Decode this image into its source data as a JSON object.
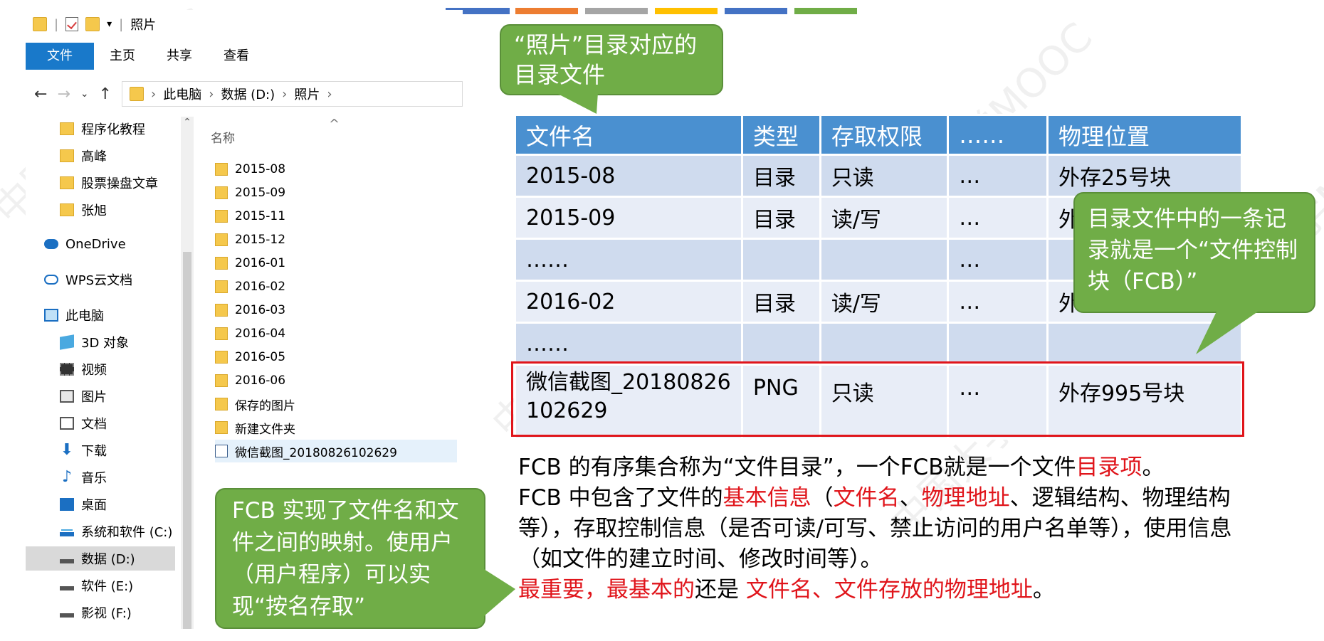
{
  "colors": {
    "strip": [
      "#4472c4",
      "#ed7d31",
      "#a5a5a5",
      "#ffc000",
      "#4472c4",
      "#70ad47"
    ],
    "accent_blue": "#1979ca",
    "table_header": "#4a90d0",
    "callout_green": "#70ad47",
    "highlight_red": "#e0151b"
  },
  "explorer": {
    "title": "照片",
    "ribbon_tabs": [
      "文件",
      "主页",
      "共享",
      "查看"
    ],
    "address": [
      "此电脑",
      "数据 (D:)",
      "照片"
    ],
    "nav_items": [
      {
        "label": "程序化教程",
        "icon": "folder-icon"
      },
      {
        "label": "高峰",
        "icon": "folder-icon"
      },
      {
        "label": "股票操盘文章",
        "icon": "folder-icon"
      },
      {
        "label": "张旭",
        "icon": "folder-icon"
      },
      {
        "label": "OneDrive",
        "icon": "onedrive-icon"
      },
      {
        "label": "WPS云文档",
        "icon": "wps-cloud-icon"
      },
      {
        "label": "此电脑",
        "icon": "computer-icon"
      },
      {
        "label": "3D 对象",
        "icon": "3d-objects-icon"
      },
      {
        "label": "视频",
        "icon": "video-icon"
      },
      {
        "label": "图片",
        "icon": "pictures-icon"
      },
      {
        "label": "文档",
        "icon": "documents-icon"
      },
      {
        "label": "下载",
        "icon": "download-icon"
      },
      {
        "label": "音乐",
        "icon": "music-icon"
      },
      {
        "label": "桌面",
        "icon": "desktop-icon"
      },
      {
        "label": "系统和软件 (C:)",
        "icon": "system-drive-icon"
      },
      {
        "label": "数据 (D:)",
        "icon": "drive-icon"
      },
      {
        "label": "软件 (E:)",
        "icon": "drive-icon"
      },
      {
        "label": "影视 (F:)",
        "icon": "drive-icon"
      }
    ],
    "column_header": "名称",
    "files": [
      "2015-08",
      "2015-09",
      "2015-11",
      "2015-12",
      "2016-01",
      "2016-02",
      "2016-03",
      "2016-04",
      "2016-05",
      "2016-06",
      "保存的图片",
      "新建文件夹",
      "微信截图_20180826102629"
    ]
  },
  "table": {
    "headers": [
      "文件名",
      "类型",
      "存取权限",
      "……",
      "物理位置"
    ],
    "rows": [
      [
        "2015-08",
        "目录",
        "只读",
        "…",
        "外存25号块"
      ],
      [
        "2015-09",
        "目录",
        "读/写",
        "…",
        "外"
      ],
      [
        "……",
        "",
        "",
        "…",
        ""
      ],
      [
        "2016-02",
        "目录",
        "读/写",
        "…",
        "外存"
      ],
      [
        "……",
        "",
        "",
        "",
        ""
      ],
      [
        "微信截图_20180826102629",
        "PNG",
        "只读",
        "…",
        "外存995号块"
      ]
    ]
  },
  "callouts": {
    "top": "“照片”目录对应的目录文件",
    "right": "目录文件中的一条记录就是一个“文件控制块（FCB）”",
    "bottom_left": "FCB 实现了文件名和文件之间的映射。使用户（用户程序）可以实现“按名存取”"
  },
  "paragraph": {
    "p1_a": "FCB 的有序集合称为“文件目录”，一个FCB就是一个文件",
    "p1_red": "目录项",
    "p1_b": "。",
    "p2_a": "FCB 中包含了文件的",
    "p2_red1": "基本信息",
    "p2_b": "（",
    "p2_red2": "文件名",
    "p2_c": "、",
    "p2_red3": "物理地址",
    "p2_d": "、逻辑结构、物理结构等），存取控制信息（是否可读/可写、禁止访问的用户名单等），使用信息（如文件的建立时间、修改时间等）。",
    "p3_red1": "最重要，最基本的",
    "p3_a": "还是 ",
    "p3_red2": "文件名、文件存放的物理地址",
    "p3_b": "。"
  },
  "watermark": "中国大学MOOC"
}
